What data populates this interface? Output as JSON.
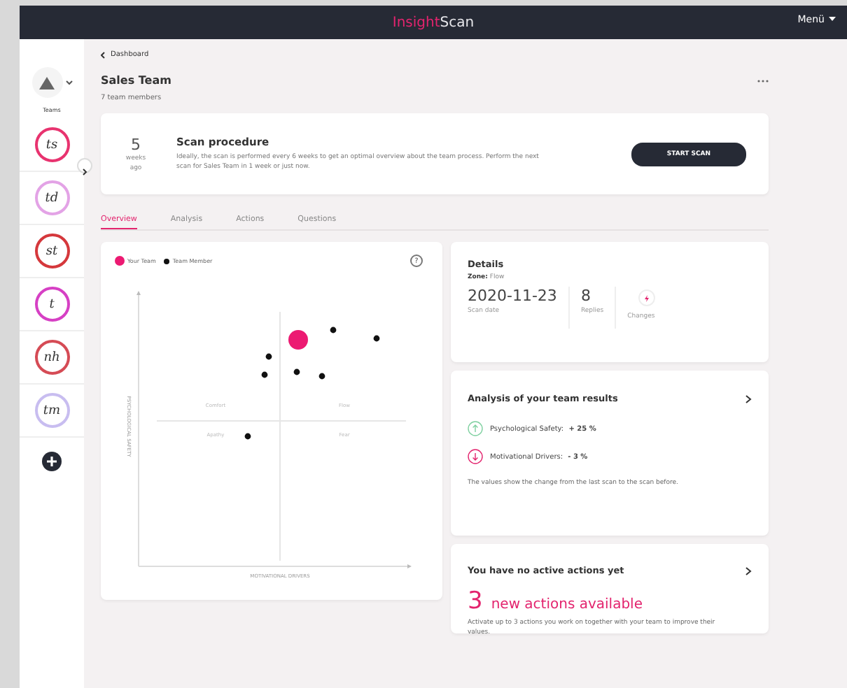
{
  "topbar": {
    "brand_first": "Insight",
    "brand_second": "Scan",
    "menu": "Menü"
  },
  "sidebar": {
    "label": "Teams",
    "teams": [
      {
        "initials": "ts",
        "color": "#e8336f",
        "selected": false
      },
      {
        "initials": "td",
        "color": "#e3a3e6",
        "selected": false
      },
      {
        "initials": "st",
        "color": "#d5383c",
        "selected": false
      },
      {
        "initials": "t",
        "color": "#d640c4",
        "selected": false
      },
      {
        "initials": "nh",
        "color": "#d54b55",
        "selected": false
      },
      {
        "initials": "tm",
        "color": "#c8bdf0",
        "selected": false
      }
    ]
  },
  "back_link": "Dashboard",
  "team": {
    "name": "Sales Team",
    "members": "7 team members"
  },
  "scan": {
    "count": "5",
    "unit_1": "weeks",
    "unit_2": "ago",
    "title": "Scan procedure",
    "text": "Ideally, the scan is performed every 6 weeks to get an optimal overview about the team process. Perform the next scan for Sales Team in 1 week or just now.",
    "button": "START SCAN"
  },
  "tabs": [
    {
      "label": "Overview",
      "selected": true
    },
    {
      "label": "Analysis",
      "selected": false
    },
    {
      "label": "Actions",
      "selected": false
    },
    {
      "label": "Questions",
      "selected": false
    }
  ],
  "chart": {
    "legend": [
      "Your Team",
      "Team Member"
    ],
    "help": "?",
    "quadrants": [
      "Comfort",
      "Flow",
      "Apathy",
      "Fear"
    ],
    "ylabel": "PSYCHOLOGICAL SAFETY",
    "xlabel": "MOTIVATIONAL DRIVERS"
  },
  "details": {
    "title": "Details",
    "zone_label": "Zone:",
    "zone": "Flow",
    "stats": [
      {
        "value": "2020-11-23",
        "label": "Scan date"
      },
      {
        "value": "8",
        "label": "Replies"
      },
      {
        "label": "Changes"
      }
    ]
  },
  "analysis": {
    "title": "Analysis of your team results",
    "items": [
      {
        "kind": "up",
        "label": "Psychological Safety:",
        "value": "+ 25 %"
      },
      {
        "kind": "down",
        "label": "Motivational Drivers:",
        "value": "- 3 %"
      }
    ],
    "note": "The values show the change from the last scan to the scan before."
  },
  "actions": {
    "title": "You have no active actions yet",
    "count": "3",
    "headline": "new actions available",
    "text": "Activate up to 3 actions you work on together with your team to improve their values."
  }
}
